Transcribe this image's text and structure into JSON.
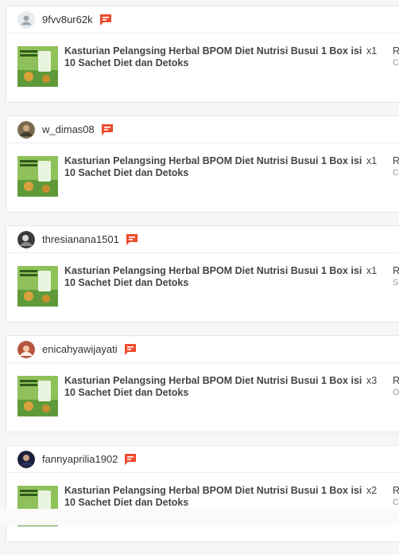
{
  "orders": [
    {
      "username": "9fvv8ur62k",
      "avatar": "default-user-avatar",
      "product": "Kasturian Pelangsing Herbal BPOM Diet Nutrisi Busui 1 Box isi 10 Sachet Diet dan Detoks",
      "quantity": "x1",
      "extra": "R",
      "extra_sub": "C"
    },
    {
      "username": "w_dimas08",
      "avatar": "user-photo-avatar",
      "product": "Kasturian Pelangsing Herbal BPOM Diet Nutrisi Busui 1 Box isi 10 Sachet Diet dan Detoks",
      "quantity": "x1",
      "extra": "R",
      "extra_sub": "C"
    },
    {
      "username": "thresianana1501",
      "avatar": "user-photo-avatar",
      "product": "Kasturian Pelangsing Herbal BPOM Diet Nutrisi Busui 1 Box isi 10 Sachet Diet dan Detoks",
      "quantity": "x1",
      "extra": "R",
      "extra_sub": "S"
    },
    {
      "username": "enicahyawijayati",
      "avatar": "user-photo-avatar",
      "product": "Kasturian Pelangsing Herbal BPOM Diet Nutrisi Busui 1 Box isi 10 Sachet Diet dan Detoks",
      "quantity": "x3",
      "extra": "R",
      "extra_sub": "O"
    },
    {
      "username": "fannyaprilia1902",
      "avatar": "user-photo-avatar",
      "product": "Kasturian Pelangsing Herbal BPOM Diet Nutrisi Busui 1 Box isi 10 Sachet Diet dan Detoks",
      "quantity": "x2",
      "extra": "R",
      "extra_sub": "C"
    }
  ],
  "thumbnail_label": "MINUMAN KASTURIAN",
  "colors": {
    "chat_icon": "#ee4d2d",
    "thumb_bg": "#8fc15a",
    "card_border": "#e6e6e6"
  }
}
